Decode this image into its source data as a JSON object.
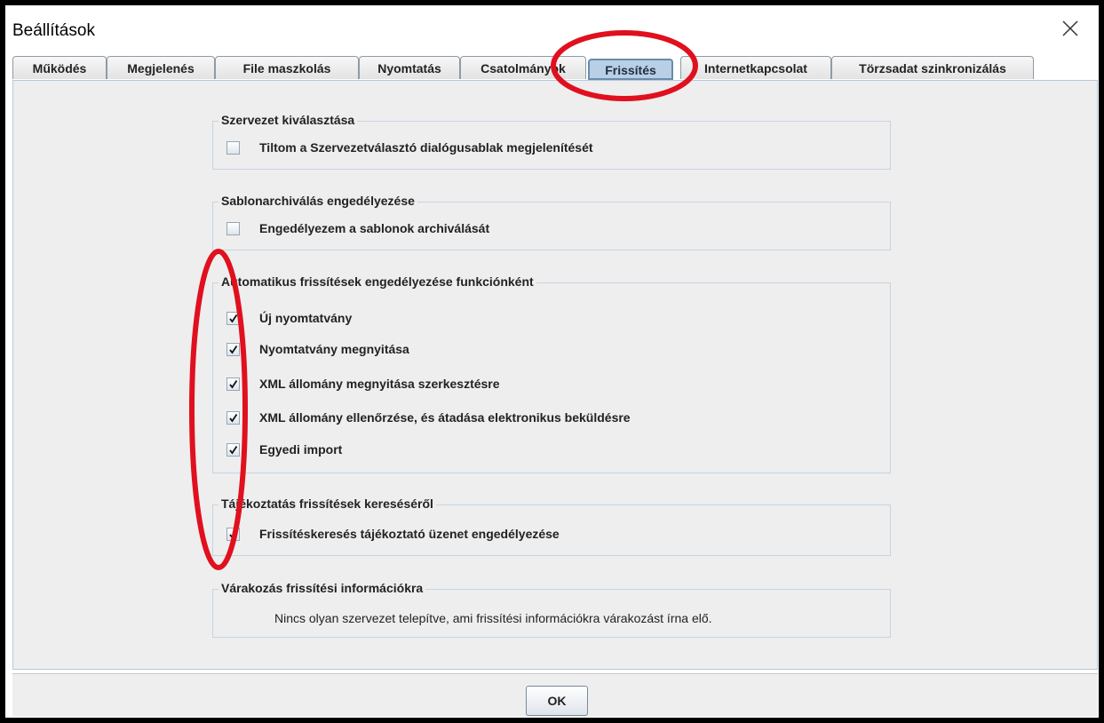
{
  "window": {
    "title": "Beállítások"
  },
  "tabs": [
    {
      "label": "Működés"
    },
    {
      "label": "Megjelenés"
    },
    {
      "label": "File maszkolás"
    },
    {
      "label": "Nyomtatás"
    },
    {
      "label": "Csatolmányok"
    },
    {
      "label": "Frissítés"
    },
    {
      "label": "Internetkapcsolat"
    },
    {
      "label": "Törzsadat szinkronizálás"
    }
  ],
  "active_tab": "Frissítés",
  "groups": {
    "org": {
      "title": "Szervezet kiválasztása",
      "items": [
        {
          "label": "Tiltom a Szervezetválasztó dialógusablak megjelenítését",
          "checked": false
        }
      ]
    },
    "template": {
      "title": "Sablonarchiválás engedélyezése",
      "items": [
        {
          "label": "Engedélyezem a sablonok archiválását",
          "checked": false
        }
      ]
    },
    "auto": {
      "title": "Automatikus frissítések engedélyezése funkciónként",
      "items": [
        {
          "label": "Új nyomtatvány",
          "checked": true
        },
        {
          "label": "Nyomtatvány megnyitása",
          "checked": true
        },
        {
          "label": "XML állomány megnyitása szerkesztésre",
          "checked": true
        },
        {
          "label": "XML állomány ellenőrzése, és átadása elektronikus beküldésre",
          "checked": true
        },
        {
          "label": "Egyedi import",
          "checked": true
        }
      ]
    },
    "info": {
      "title": "Tájékoztatás frissítések kereséséről",
      "items": [
        {
          "label": "Frissítéskeresés tájékoztató üzenet engedélyezése",
          "checked": true
        }
      ]
    },
    "waiting": {
      "title": "Várakozás frissítési információkra",
      "message": "Nincs olyan szervezet telepítve, ami frissítési információkra várakozást írna elő."
    }
  },
  "buttons": {
    "ok": "OK"
  },
  "annotation_color": "#e0101e",
  "icons": {
    "close": "close-icon",
    "check": "checkmark-icon"
  }
}
